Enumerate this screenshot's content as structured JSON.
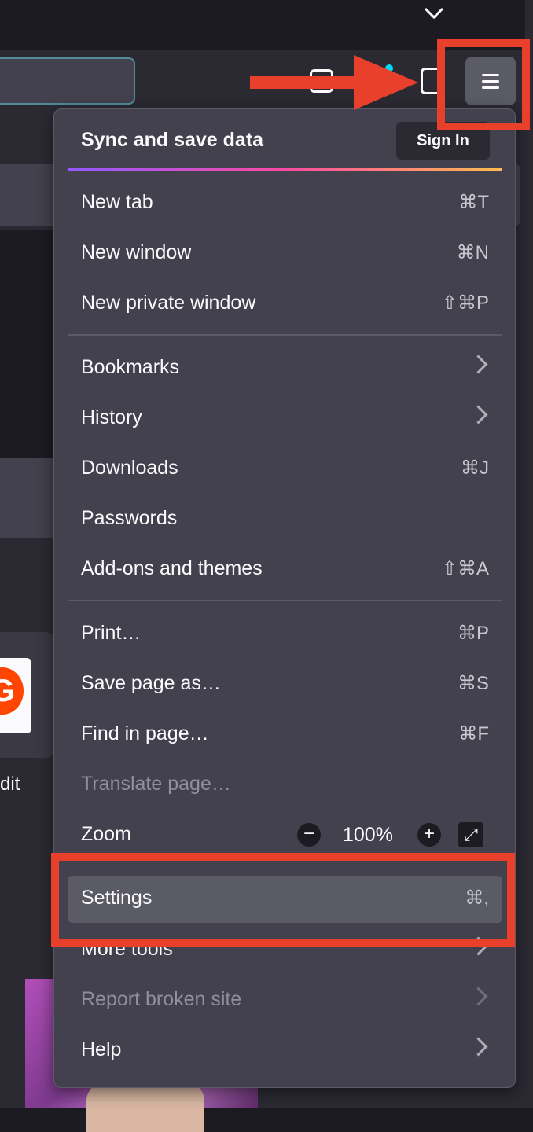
{
  "colors": {
    "panel": "#42414d",
    "annotation": "#e8402a",
    "accent": "#9059ff"
  },
  "toolbar": {
    "tabs_chevron_icon": "chevron-down-icon",
    "menu_icon": "hamburger-icon"
  },
  "page": {
    "tile_letter": "G",
    "tile_label": "dit"
  },
  "menu": {
    "sync_title": "Sync and save data",
    "sign_in": "Sign In",
    "items": [
      {
        "label": "New tab",
        "shortcut": "⌘T"
      },
      {
        "label": "New window",
        "shortcut": "⌘N"
      },
      {
        "label": "New private window",
        "shortcut": "⇧⌘P"
      },
      {
        "label": "Bookmarks",
        "submenu": true
      },
      {
        "label": "History",
        "submenu": true
      },
      {
        "label": "Downloads",
        "shortcut": "⌘J"
      },
      {
        "label": "Passwords"
      },
      {
        "label": "Add-ons and themes",
        "shortcut": "⇧⌘A"
      },
      {
        "label": "Print…",
        "shortcut": "⌘P"
      },
      {
        "label": "Save page as…",
        "shortcut": "⌘S"
      },
      {
        "label": "Find in page…",
        "shortcut": "⌘F"
      },
      {
        "label": "Translate page…",
        "disabled": true
      },
      {
        "label": "Settings",
        "shortcut": "⌘,",
        "highlighted": true
      },
      {
        "label": "More tools",
        "submenu": true
      },
      {
        "label": "Report broken site",
        "submenu": true,
        "disabled": true
      },
      {
        "label": "Help",
        "submenu": true
      }
    ],
    "zoom": {
      "label": "Zoom",
      "minus": "−",
      "value": "100%",
      "plus": "+",
      "fullscreen_icon": "fullscreen-icon"
    }
  }
}
